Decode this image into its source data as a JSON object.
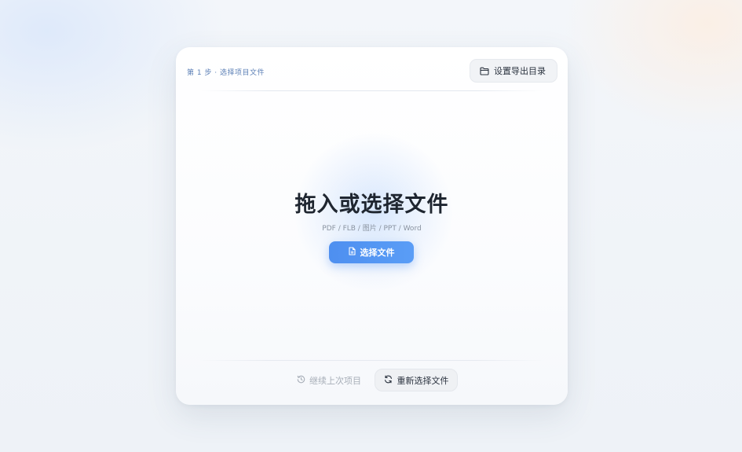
{
  "card": {
    "step_label": "第 1 步 · 选择项目文件",
    "export_button_label": "设置导出目录",
    "export_button_icon": "folder-icon"
  },
  "dropzone": {
    "title": "拖入或选择文件",
    "formats": "PDF / FLB / 图片 / PPT / Word",
    "choose_button_label": "选择文件",
    "choose_button_icon": "file-icon"
  },
  "footer": {
    "continue_label": "继续上次项目",
    "continue_icon": "history-icon",
    "reselect_label": "重新选择文件",
    "reselect_icon": "refresh-icon"
  },
  "colors": {
    "accent": "#4e8ff0",
    "title": "#1f2630",
    "step_label": "#5b7fb6",
    "disabled_text": "#a7aeb8"
  }
}
